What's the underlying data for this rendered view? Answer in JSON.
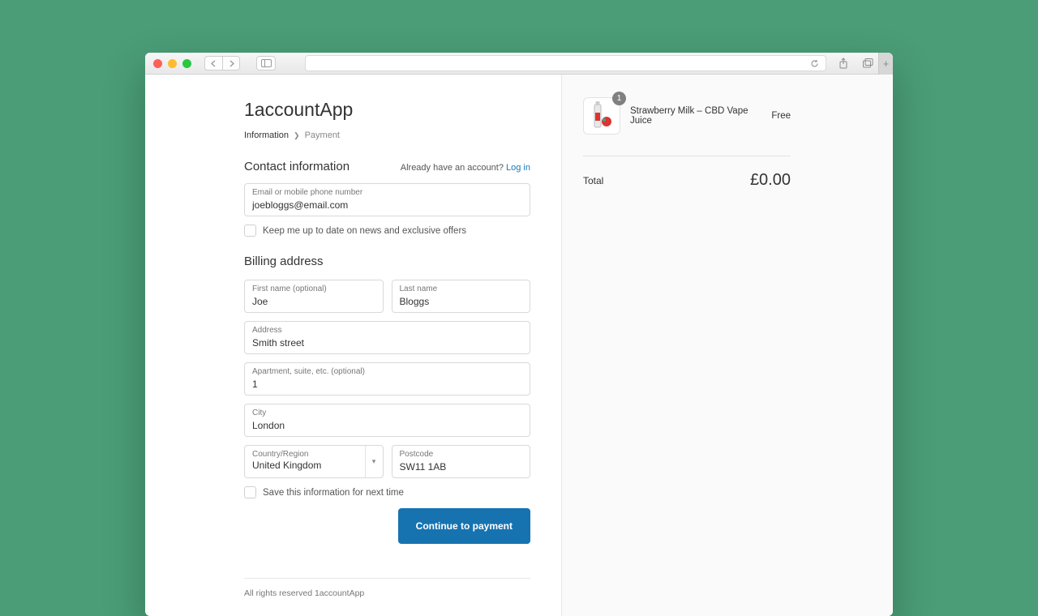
{
  "shop": {
    "name": "1accountApp"
  },
  "breadcrumb": {
    "current": "Information",
    "next": "Payment"
  },
  "contact": {
    "title": "Contact information",
    "already_prompt": "Already have an account? ",
    "login_link": "Log in",
    "email_label": "Email or mobile phone number",
    "email_value": "joebloggs@email.com",
    "newsletter_label": "Keep me up to date on news and exclusive offers"
  },
  "billing": {
    "title": "Billing address",
    "first_name_label": "First name (optional)",
    "first_name_value": "Joe",
    "last_name_label": "Last name",
    "last_name_value": "Bloggs",
    "address_label": "Address",
    "address_value": "Smith street",
    "apt_label": "Apartment, suite, etc. (optional)",
    "apt_value": "1",
    "city_label": "City",
    "city_value": "London",
    "country_label": "Country/Region",
    "country_value": "United Kingdom",
    "postcode_label": "Postcode",
    "postcode_value": "SW11 1AB",
    "save_label": "Save this information for next time"
  },
  "submit_label": "Continue to payment",
  "footer": "All rights reserved 1accountApp",
  "cart": {
    "items": [
      {
        "name": "Strawberry Milk – CBD Vape Juice",
        "price": "Free",
        "qty": "1"
      }
    ],
    "total_label": "Total",
    "total_amount": "£0.00"
  }
}
